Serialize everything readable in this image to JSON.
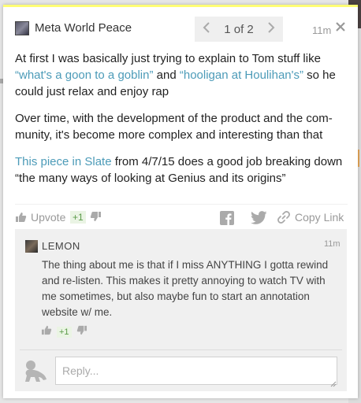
{
  "annotation": {
    "author": "Meta World Peace",
    "pager_label": "1 of 2",
    "time": "11m",
    "paragraphs": [
      [
        {
          "text": "At first I was basically just trying to explain to Tom stuff like ",
          "link": false
        },
        {
          "text": "“what's a goon to a goblin”",
          "link": true
        },
        {
          "text": " and ",
          "link": false
        },
        {
          "text": "“hooligan at Houlihan's”",
          "link": true
        },
        {
          "text": " so he could just relax and enjoy rap",
          "link": false
        }
      ],
      [
        {
          "text": "Over time, with the development of the product and the com-munity, it's become more complex and interesting than that",
          "link": false
        }
      ],
      [
        {
          "text": "This piece in Slate",
          "link": true
        },
        {
          "text": " from 4/7/15 does a good job breaking down “the many ways of looking at Genius and its origins”",
          "link": false
        }
      ]
    ]
  },
  "actions": {
    "upvote_label": "Upvote",
    "vote_count": "+1",
    "copy_link_label": "Copy Link"
  },
  "reply": {
    "author": "LEMON",
    "time": "11m",
    "text": "The thing about me is that if I miss ANYTHING I gotta rewind and re-listen. This makes it pretty annoying to watch TV with me sometimes, but also maybe fun to start an annotation website w/ me.",
    "vote_count": "+1",
    "input_placeholder": "Reply..."
  },
  "icons": [
    "user-avatar",
    "chevron-left-icon",
    "chevron-right-icon",
    "close-icon",
    "thumbs-up-icon",
    "thumbs-down-icon",
    "facebook-icon",
    "twitter-icon",
    "link-icon",
    "baby-avatar-icon"
  ],
  "colors": {
    "link": "#4c9bb8",
    "accent_top_border": "#fffd74",
    "vote_badge": "#5a9a48",
    "reply_background": "#f0f0f0"
  }
}
